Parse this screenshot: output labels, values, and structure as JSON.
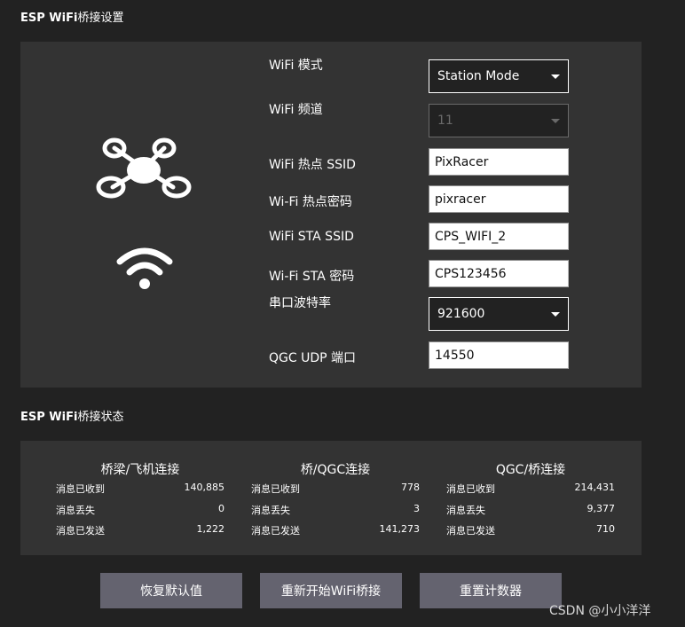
{
  "settings": {
    "title_latin": "ESP WiFi",
    "title_cn": "桥接设置",
    "rows": {
      "wifi_mode": {
        "label": "WiFi 模式",
        "value": "Station Mode"
      },
      "wifi_channel": {
        "label": "WiFi 频道",
        "value": "11",
        "disabled": true
      },
      "ap_ssid": {
        "label": "WiFi 热点 SSID",
        "value": "PixRacer"
      },
      "ap_password": {
        "label": "Wi-Fi 热点密码",
        "value": "pixracer"
      },
      "sta_ssid": {
        "label": "WiFi STA SSID",
        "value": "CPS_WIFI_2"
      },
      "sta_password": {
        "label": "Wi-Fi STA 密码",
        "value": "CPS123456"
      },
      "baud_rate": {
        "label": "串口波特率",
        "value": "921600"
      },
      "udp_port": {
        "label": "QGC UDP 端口",
        "value": "14550"
      }
    },
    "icons": {
      "vehicle": "drone-icon",
      "wifi": "wifi-icon"
    }
  },
  "status": {
    "title_latin": "ESP WiFi",
    "title_cn": "桥接状态",
    "columns": [
      {
        "heading": "桥梁/飞机连接",
        "rows": [
          {
            "label": "消息已收到",
            "value": "140,885"
          },
          {
            "label": "消息丢失",
            "value": "0"
          },
          {
            "label": "消息已发送",
            "value": "1,222"
          }
        ]
      },
      {
        "heading": "桥/QGC连接",
        "rows": [
          {
            "label": "消息已收到",
            "value": "778"
          },
          {
            "label": "消息丢失",
            "value": "3"
          },
          {
            "label": "消息已发送",
            "value": "141,273"
          }
        ]
      },
      {
        "heading": "QGC/桥连接",
        "rows": [
          {
            "label": "消息已收到",
            "value": "214,431"
          },
          {
            "label": "消息丢失",
            "value": "9,377"
          },
          {
            "label": "消息已发送",
            "value": "710"
          }
        ]
      }
    ]
  },
  "buttons": {
    "restore_defaults": "恢复默认值",
    "restart_bridge": "重新开始WiFi桥接",
    "reset_counters": "重置计数器"
  },
  "colors": {
    "background": "#222222",
    "panel": "#333333",
    "button": "#64636f"
  },
  "watermark": "CSDN @小小洋洋"
}
